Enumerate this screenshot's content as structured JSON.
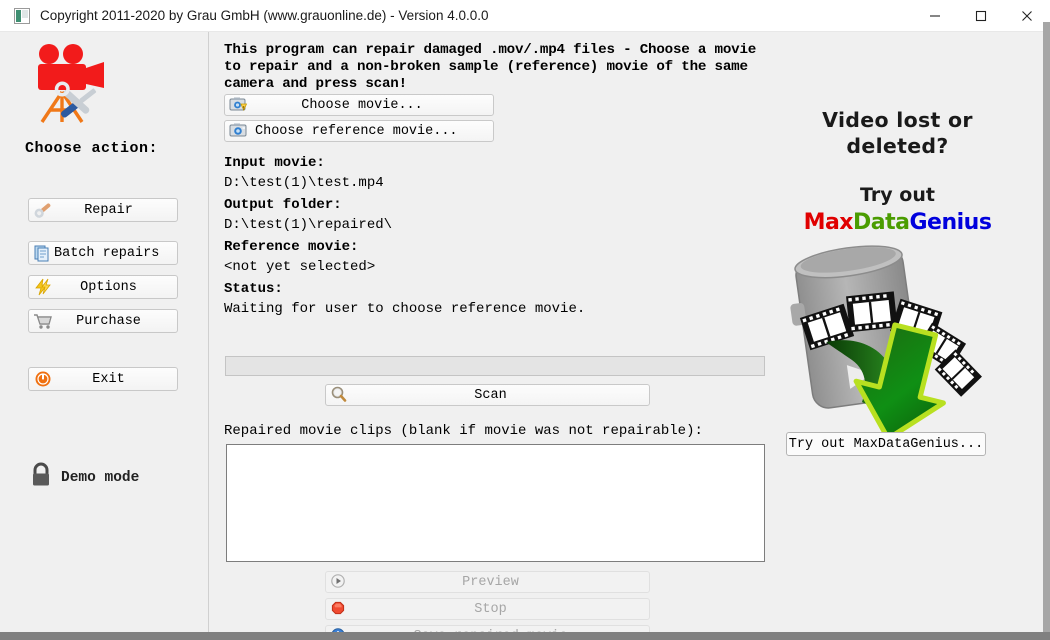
{
  "window": {
    "title": "Copyright 2011-2020 by Grau GmbH (www.grauonline.de) - Version 4.0.0.0",
    "icon": "app-icon",
    "minimize": "—",
    "maximize": "□",
    "close": "×"
  },
  "sidebar": {
    "logo_alt": "movie-camera-repair-logo",
    "heading": "Choose action:",
    "buttons": [
      {
        "label": "Repair",
        "icon": "wrench-icon"
      },
      {
        "label": "Batch repairs",
        "icon": "documents-icon"
      },
      {
        "label": "Options",
        "icon": "lightning-icon"
      },
      {
        "label": "Purchase",
        "icon": "shopping-cart-icon"
      },
      {
        "label": "Exit",
        "icon": "power-icon"
      }
    ],
    "demo": {
      "label": "Demo mode",
      "icon": "lock-icon"
    }
  },
  "main": {
    "description": "This program can repair damaged .mov/.mp4 files - Choose a movie to repair and a non-broken sample (reference) movie of the same camera and press scan!",
    "choose_movie": {
      "label": "Choose movie...",
      "icon": "camera-warning-icon"
    },
    "choose_reference": {
      "label": "Choose reference movie...",
      "icon": "camera-icon"
    },
    "fields": [
      {
        "key": "Input movie:",
        "value": "D:\\test(1)\\test.mp4"
      },
      {
        "key": "Output folder:",
        "value": "D:\\test(1)\\repaired\\"
      },
      {
        "key": "Reference movie:",
        "value": "<not yet selected>"
      },
      {
        "key": "Status:",
        "value": "Waiting for user to choose reference movie."
      }
    ],
    "progress": {
      "percent": 0
    },
    "scan": {
      "label": "Scan",
      "icon": "magnifier-icon"
    },
    "clips_label": "Repaired movie clips (blank if movie was not repairable):",
    "clips_value": "",
    "preview": {
      "label": "Preview",
      "icon": "play-circle-icon",
      "disabled": true
    },
    "stop": {
      "label": "Stop",
      "icon": "stop-red-icon",
      "disabled": true
    },
    "third": {
      "label": "Save repaired movie",
      "icon": "save-blue-icon",
      "disabled": true
    }
  },
  "promo": {
    "headline": "Video lost or deleted?",
    "subhead": "Try out",
    "brand_parts": [
      {
        "text": "Max",
        "color": "#e00000"
      },
      {
        "text": "Data",
        "color": "#4a9c00"
      },
      {
        "text": "Genius",
        "color": "#0000dd"
      }
    ],
    "art_alt": "recycle-bin-film-recovery-art",
    "button": "Try out MaxDataGenius..."
  }
}
